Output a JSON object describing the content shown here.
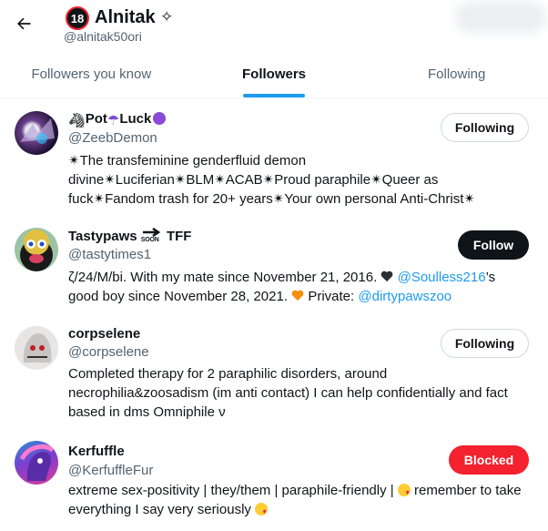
{
  "header": {
    "name": "Alnitak",
    "badge": "18",
    "handle": "@alnitak50ori"
  },
  "tabs": [
    {
      "label": "Followers you know"
    },
    {
      "label": "Followers"
    },
    {
      "label": "Following"
    }
  ],
  "users": [
    {
      "name_a": "Pot",
      "name_b": "Luck",
      "handle": "@ZeebDemon",
      "bio": "✴The transfeminine genderfluid demon divine✴Luciferian✴BLM✴ACAB✴Proud paraphile✴Queer as fuck✴Fandom trash for 20+ years✴Your own personal Anti-Christ✴",
      "button": "Following"
    },
    {
      "name_a": "Tastypaws",
      "name_b": "TFF",
      "soon": "SOON",
      "handle": "@tastytimes1",
      "bio_a": "ζ/24/M/bi. With my mate since November 21, 2016.",
      "mention_1": "@Soulless216",
      "bio_b": "’s good boy since November 28, 2021.",
      "bio_c": " Private:",
      "mention_2": "@dirtypawszoo",
      "button": "Follow"
    },
    {
      "name": "corpselene",
      "handle": "@corpselene",
      "bio": "Completed therapy for 2 paraphilic disorders, around necrophilia&zoosadism (im anti contact) I can help confidentially and fact based in dms Omniphile ν",
      "button": "Following"
    },
    {
      "name": "Kerfuffle",
      "handle": "@KerfuffleFur",
      "bio_a": "extreme sex-positivity | they/them | paraphile-friendly |",
      "bio_b": " remember to take everything I say very seriously",
      "button": "Blocked"
    }
  ],
  "colors": {
    "accent": "#1d9bf0",
    "blocked": "#f4212e",
    "secondary_text": "#536471"
  }
}
